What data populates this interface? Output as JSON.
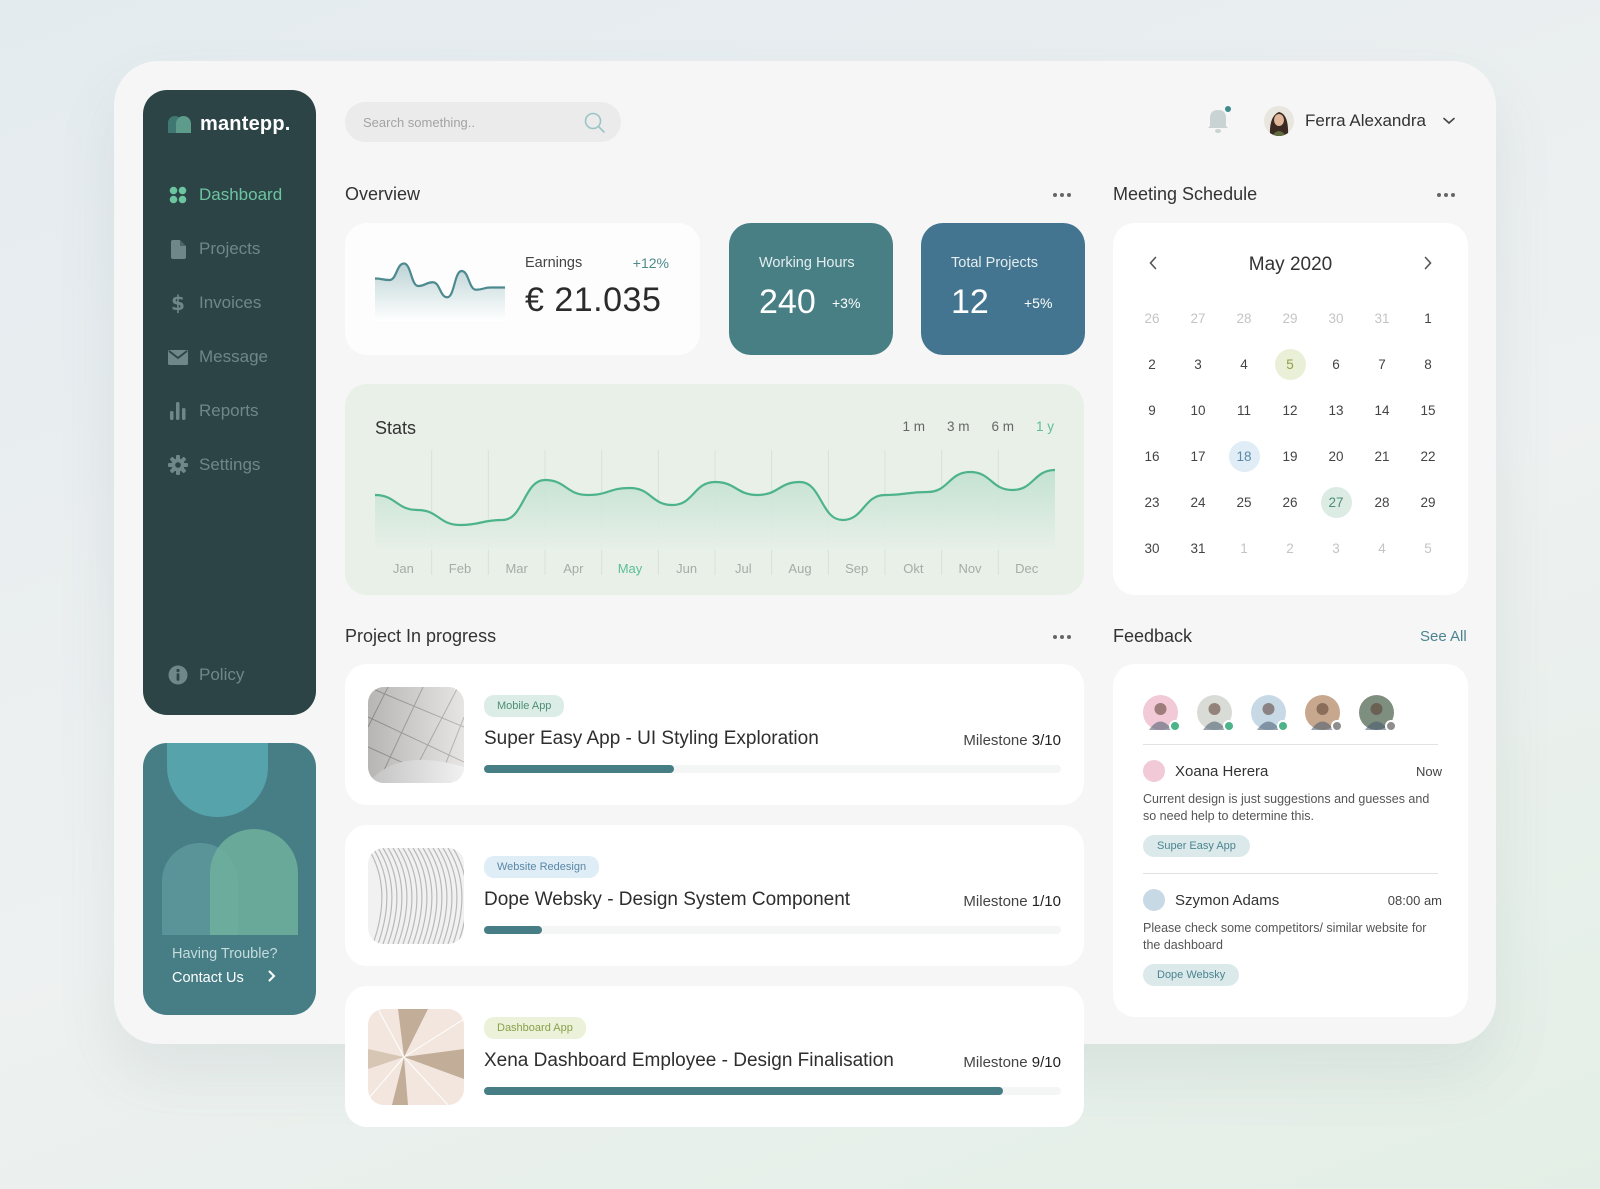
{
  "brand": {
    "name": "mantepp."
  },
  "sidebar": {
    "items": [
      {
        "label": "Dashboard",
        "icon": "grid-icon",
        "active": true
      },
      {
        "label": "Projects",
        "icon": "file-icon"
      },
      {
        "label": "Invoices",
        "icon": "dollar-icon"
      },
      {
        "label": "Message",
        "icon": "mail-icon"
      },
      {
        "label": "Reports",
        "icon": "bar-chart-icon"
      },
      {
        "label": "Settings",
        "icon": "gear-icon"
      }
    ],
    "policy": {
      "label": "Policy",
      "icon": "info-icon"
    }
  },
  "help": {
    "title": "Having Trouble?",
    "cta": "Contact Us"
  },
  "topbar": {
    "search_placeholder": "Search something..",
    "user_name": "Ferra Alexandra",
    "has_notification": true
  },
  "overview": {
    "title": "Overview",
    "earnings": {
      "label": "Earnings",
      "change": "+12%",
      "value": "€ 21.035",
      "sparkline": [
        50,
        48,
        70,
        40,
        45,
        25,
        60,
        35,
        38,
        38
      ]
    },
    "working_hours": {
      "label": "Working Hours",
      "value": "240",
      "change": "+3%"
    },
    "total_projects": {
      "label": "Total Projects",
      "value": "12",
      "change": "+5%"
    }
  },
  "stats": {
    "title": "Stats",
    "ranges": [
      "1 m",
      "3 m",
      "6 m",
      "1 y"
    ],
    "active_range": "1 y",
    "active_month": "May",
    "chart_data": {
      "type": "area",
      "categories": [
        "Jan",
        "Feb",
        "Mar",
        "Apr",
        "May",
        "Jun",
        "Jul",
        "Aug",
        "Sep",
        "Okt",
        "Nov",
        "Dec"
      ],
      "values": [
        55,
        40,
        25,
        30,
        70,
        55,
        62,
        45,
        68,
        55,
        68,
        30,
        55,
        58,
        78,
        60,
        80
      ]
    }
  },
  "meeting": {
    "title": "Meeting Schedule",
    "month_label": "May 2020",
    "days": [
      {
        "d": "26",
        "m": true
      },
      {
        "d": "27",
        "m": true
      },
      {
        "d": "28",
        "m": true
      },
      {
        "d": "29",
        "m": true
      },
      {
        "d": "30",
        "m": true
      },
      {
        "d": "31",
        "m": true
      },
      {
        "d": "1"
      },
      {
        "d": "2"
      },
      {
        "d": "3"
      },
      {
        "d": "4"
      },
      {
        "d": "5",
        "h": "green"
      },
      {
        "d": "6"
      },
      {
        "d": "7"
      },
      {
        "d": "8"
      },
      {
        "d": "9"
      },
      {
        "d": "10"
      },
      {
        "d": "11"
      },
      {
        "d": "12"
      },
      {
        "d": "13"
      },
      {
        "d": "14"
      },
      {
        "d": "15"
      },
      {
        "d": "16"
      },
      {
        "d": "17"
      },
      {
        "d": "18",
        "h": "blue"
      },
      {
        "d": "19"
      },
      {
        "d": "20"
      },
      {
        "d": "21"
      },
      {
        "d": "22"
      },
      {
        "d": "23"
      },
      {
        "d": "24"
      },
      {
        "d": "25"
      },
      {
        "d": "26"
      },
      {
        "d": "27",
        "h": "teal"
      },
      {
        "d": "28"
      },
      {
        "d": "29"
      },
      {
        "d": "30"
      },
      {
        "d": "31"
      },
      {
        "d": "1",
        "m": true
      },
      {
        "d": "2",
        "m": true
      },
      {
        "d": "3",
        "m": true
      },
      {
        "d": "4",
        "m": true
      },
      {
        "d": "5",
        "m": true
      }
    ]
  },
  "projects": {
    "title": "Project In progress",
    "items": [
      {
        "tag": "Mobile App",
        "tag_style": "mobile",
        "name": "Super Easy App - UI Styling Exploration",
        "milestone_label": "Milestone",
        "milestone": "3/10",
        "progress": 0.33
      },
      {
        "tag": "Website Redesign",
        "tag_style": "web",
        "name": "Dope Websky - Design System Component",
        "milestone_label": "Milestone",
        "milestone": "1/10",
        "progress": 0.1
      },
      {
        "tag": "Dashboard App",
        "tag_style": "dash",
        "name": "Xena Dashboard Employee - Design Finalisation",
        "milestone_label": "Milestone",
        "milestone": "9/10",
        "progress": 0.9
      }
    ]
  },
  "feedback": {
    "title": "Feedback",
    "see_all": "See All",
    "avatars": [
      {
        "status": "online",
        "color": "#f2c9d6"
      },
      {
        "status": "online",
        "color": "#d9dcd6"
      },
      {
        "status": "online",
        "color": "#c8d9e6"
      },
      {
        "status": "offline",
        "color": "#c7a88f"
      },
      {
        "status": "offline",
        "color": "#7f8f7f"
      }
    ],
    "entries": [
      {
        "name": "Xoana Herera",
        "time": "Now",
        "message": "Current design is  just suggestions and guesses and so need help to determine this.",
        "chip": "Super Easy App"
      },
      {
        "name": "Szymon Adams",
        "time": "08:00 am",
        "message": "Please check some competitors/ similar website for the dashboard",
        "chip": "Dope Websky"
      }
    ]
  }
}
